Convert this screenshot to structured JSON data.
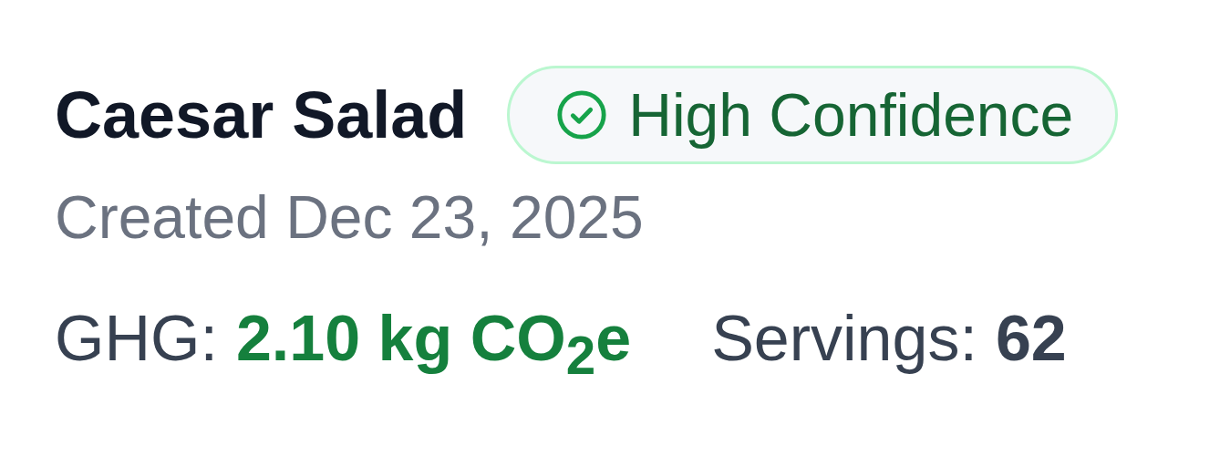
{
  "recipe": {
    "title": "Caesar Salad",
    "confidence": {
      "kind": "high",
      "label": "High Confidence"
    },
    "created": "Created Dec 23, 2025"
  },
  "stats": [
    {
      "kind": "ghg",
      "label": "GHG:",
      "value": "2.10 kg CO$_{2}$e"
    },
    {
      "kind": "servings",
      "label": "Servings:",
      "value": "62"
    }
  ]
}
